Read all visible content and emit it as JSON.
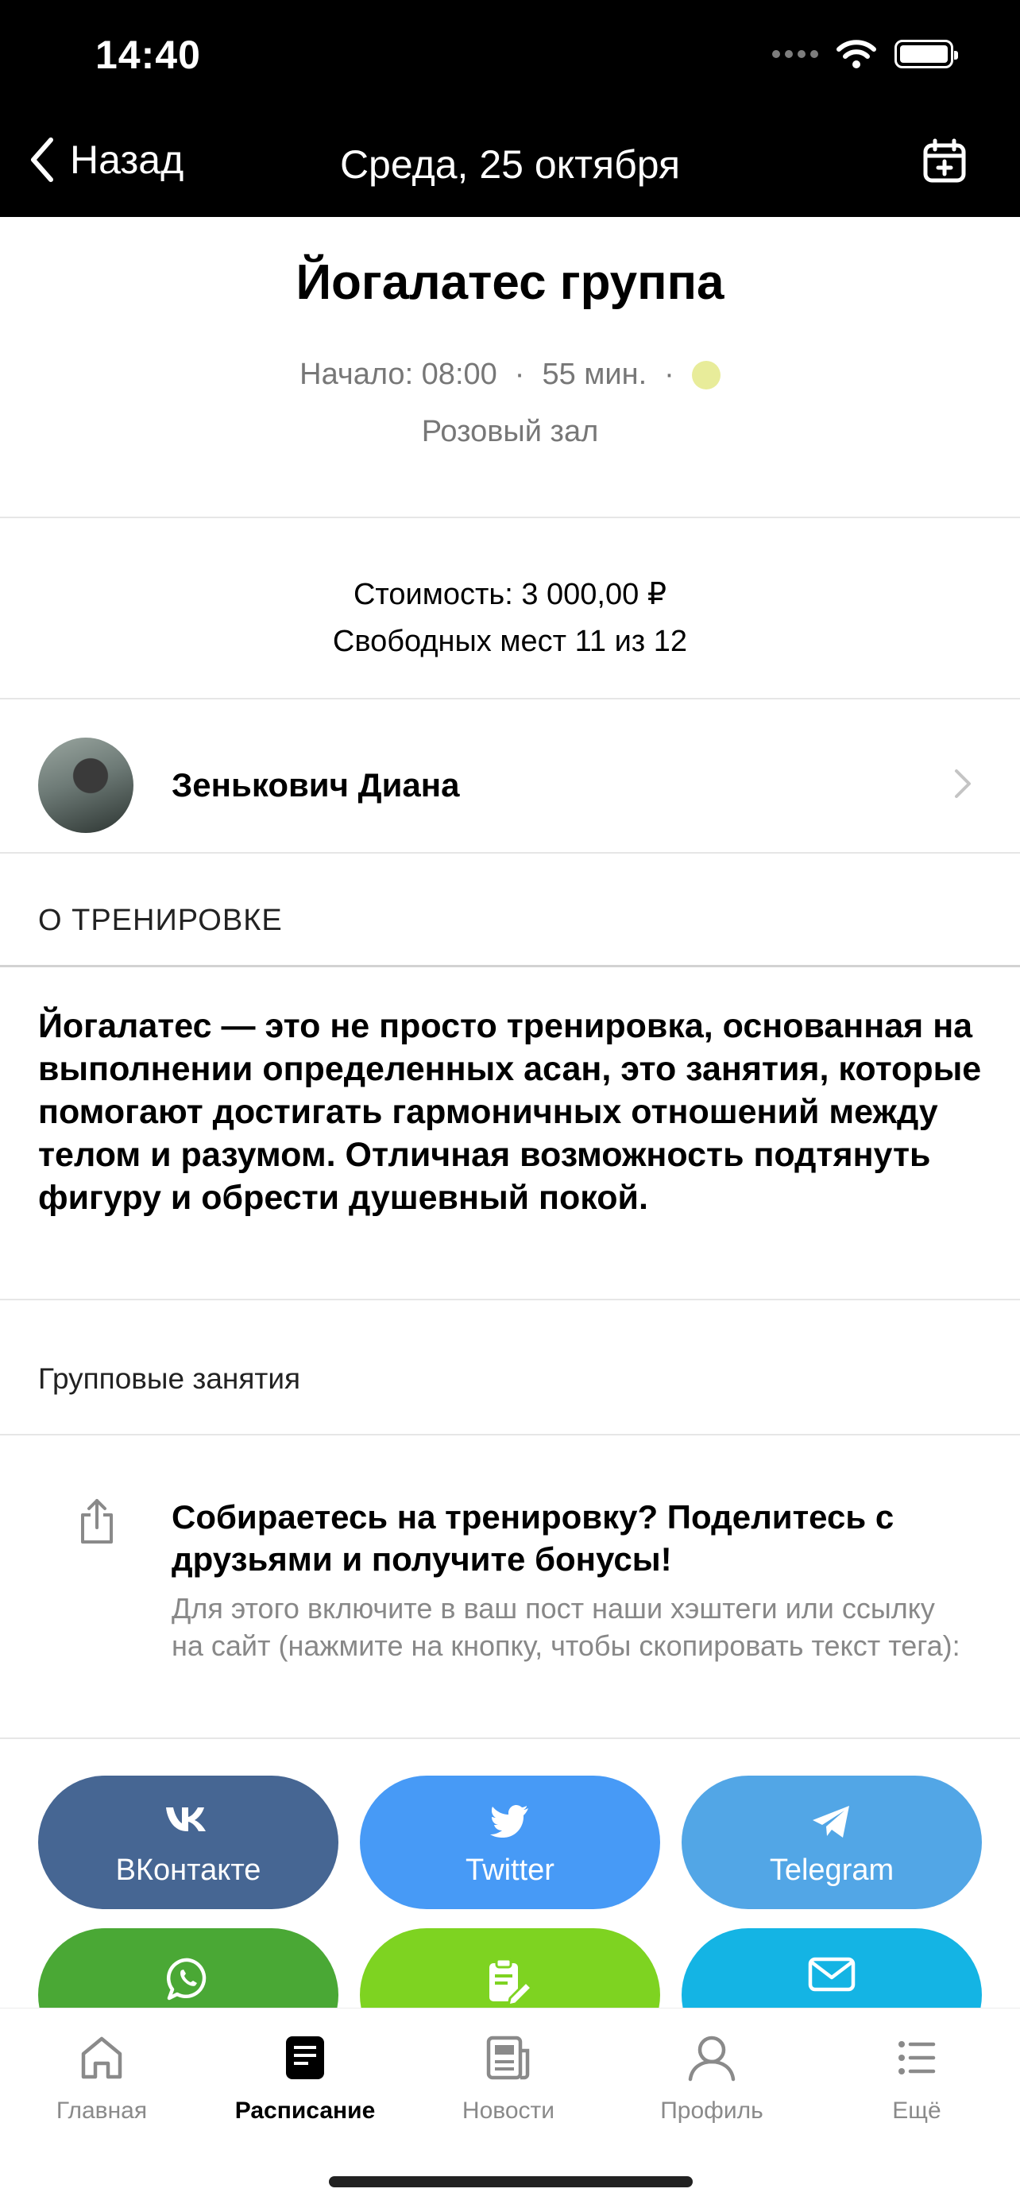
{
  "status_bar": {
    "time": "14:40"
  },
  "nav": {
    "back_label": "Назад",
    "title": "Среда, 25 октября"
  },
  "class": {
    "title": "Йогалатес группа",
    "start": "Начало: 08:00",
    "separator": "·",
    "duration": "55 мин.",
    "status_color": "#e8ec9a",
    "hall": "Розовый зал",
    "price": "Стоимость: 3 000,00 ₽",
    "seats": "Свободных мест 11 из 12"
  },
  "trainer": {
    "name": "Зенькович Диана"
  },
  "about": {
    "header": "О ТРЕНИРОВКЕ",
    "description": "Йогалатес — это не просто тренировка, основанная на выполнении определенных асан, это занятия, которые помогают достигать гармоничных отношений между телом и разумом. Отличная возможность подтянуть фигуру и обрести душевный покой."
  },
  "category": "Групповые занятия",
  "share": {
    "title": "Собираетесь на тренировку? Поделитесь с друзьями и получите бонусы!",
    "text": "Для этого включите в ваш пост наши хэштеги или ссылку на сайт (нажмите на кнопку, чтобы скопировать текст тега):",
    "buttons": [
      {
        "label": "ВКонтакте",
        "icon": "vk-icon",
        "color": "#466693"
      },
      {
        "label": "Twitter",
        "icon": "twitter-icon",
        "color": "#479af6"
      },
      {
        "label": "Telegram",
        "icon": "telegram-icon",
        "color": "#52a6e6"
      },
      {
        "label": "",
        "icon": "whatsapp-icon",
        "color": "#4aa835"
      },
      {
        "label": "",
        "icon": "clipboard-edit-icon",
        "color": "#7ed321"
      },
      {
        "label": "",
        "icon": "mail-icon",
        "color": "#14b4e4"
      }
    ]
  },
  "tabbar": {
    "items": [
      {
        "label": "Главная",
        "icon": "home-icon"
      },
      {
        "label": "Расписание",
        "icon": "schedule-icon",
        "active": true
      },
      {
        "label": "Новости",
        "icon": "news-icon"
      },
      {
        "label": "Профиль",
        "icon": "profile-icon"
      },
      {
        "label": "Ещё",
        "icon": "more-list-icon"
      }
    ]
  }
}
